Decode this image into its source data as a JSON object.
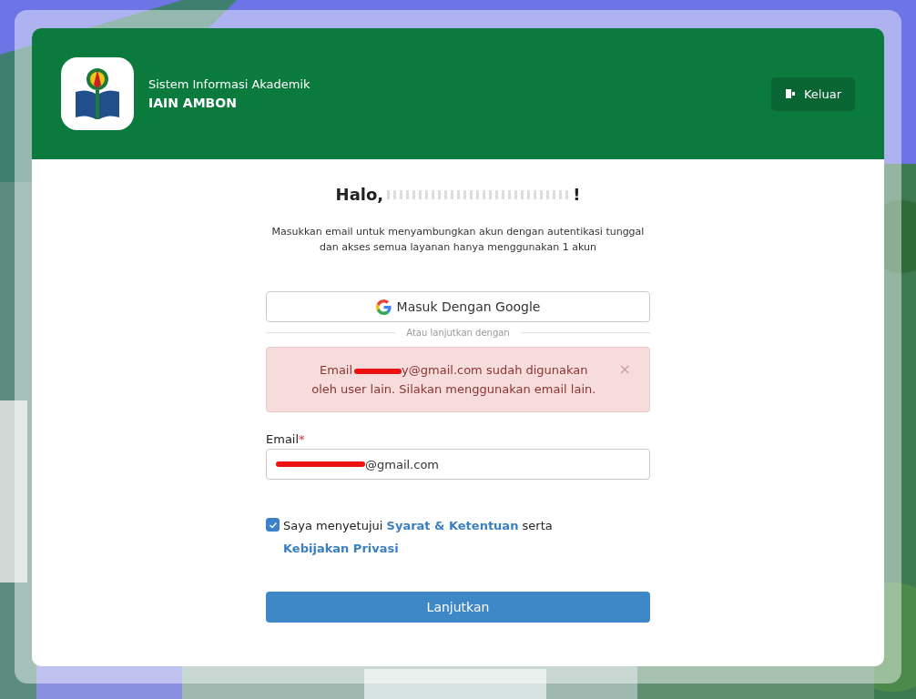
{
  "header": {
    "subtitle": "Sistem Informasi Akademik",
    "title": "IAIN AMBON",
    "logout_button": "Keluar"
  },
  "greeting": {
    "prefix": "Halo,",
    "suffix": "!"
  },
  "description": "Masukkan email untuk menyambungkan akun dengan autentikasi tunggal dan akses semua layanan hanya menggunakan 1 akun",
  "google_button": "Masuk Dengan Google",
  "divider": "Atau lanjutkan dengan",
  "alert": {
    "prefix": "Email",
    "line_1": "y@gmail.com sudah digunakan",
    "line_2": "oleh user lain. Silakan menggunakan email lain.",
    "close": "×"
  },
  "email_field": {
    "label": "Email",
    "required_mark": "*",
    "value": "@gmail.com"
  },
  "terms": {
    "checked": true,
    "text": "Saya menyetujui",
    "link_1": "Syarat & Ketentuan",
    "joiner": "serta",
    "link_2": "Kebijakan Privasi"
  },
  "submit_button": "Lanjutkan"
}
